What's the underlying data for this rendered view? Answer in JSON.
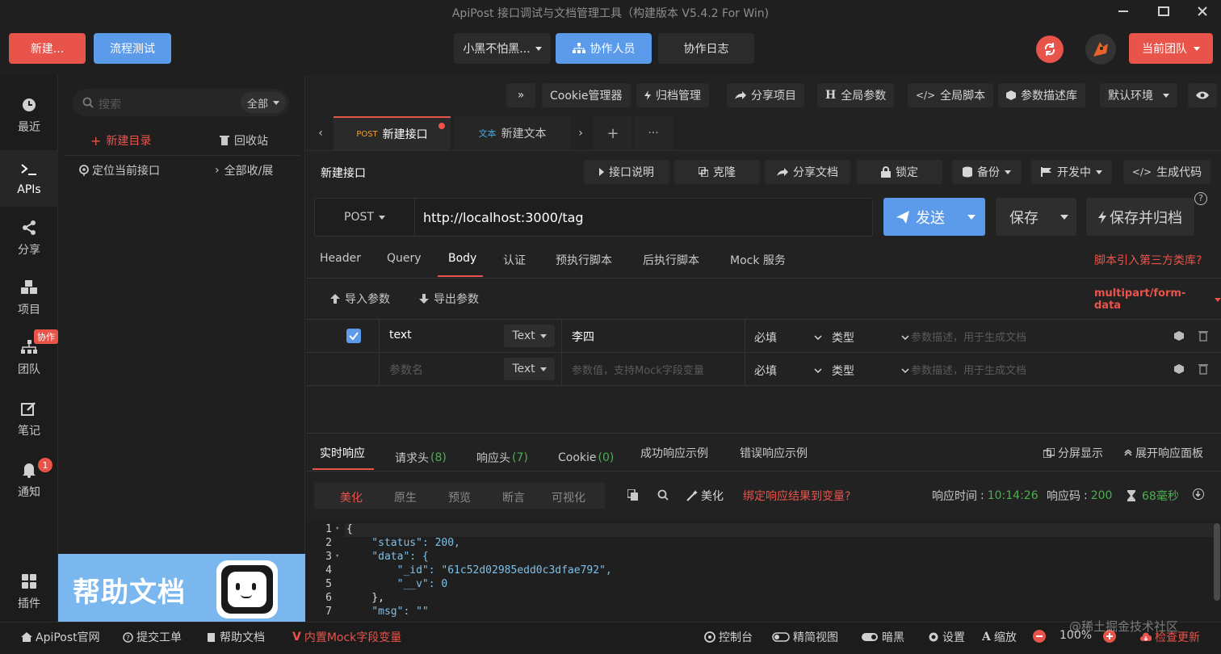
{
  "window": {
    "title": "ApiPost 接口调试与文档管理工具（构建版本 V5.4.2 For Win)"
  },
  "header": {
    "new_label": "新建...",
    "flow_test_label": "流程测试",
    "project_select": "小黑不怕黑...",
    "collaborators_label": "协作人员",
    "collab_log_label": "协作日志",
    "team_label": "当前团队"
  },
  "leftnav": {
    "items": [
      {
        "label": "最近",
        "icon": "clock-icon"
      },
      {
        "label": "APIs",
        "icon": "terminal-icon"
      },
      {
        "label": "分享",
        "icon": "share-icon"
      },
      {
        "label": "项目",
        "icon": "cubes-icon"
      },
      {
        "label": "团队",
        "icon": "sitemap-icon",
        "badge": "协作"
      },
      {
        "label": "笔记",
        "icon": "edit-icon"
      },
      {
        "label": "通知",
        "icon": "bell-icon",
        "badge": "1"
      },
      {
        "label": "插件",
        "icon": "grid-icon"
      }
    ]
  },
  "tree": {
    "search_placeholder": "搜索",
    "scope": "全部",
    "new_dir": "新建目录",
    "recycle": "回收站",
    "locate": "定位当前接口",
    "collapse_all": "全部收/展",
    "help_banner": "帮助文档"
  },
  "toolbar": {
    "expand": "»",
    "cookie": "Cookie管理器",
    "archive": "归档管理",
    "share_project": "分享项目",
    "global_params": "全局参数",
    "global_script": "全局脚本",
    "param_lib": "参数描述库",
    "env": "默认环境"
  },
  "tabs": [
    {
      "method": "POST",
      "name": "新建接口",
      "active": true,
      "dot": true
    },
    {
      "method": "文本",
      "name": "新建文本",
      "active": false
    }
  ],
  "tab_controls": {
    "add": "+",
    "more": "···"
  },
  "api": {
    "name": "新建接口",
    "doc_btn": "接口说明",
    "clone_btn": "克隆",
    "share_doc_btn": "分享文档",
    "lock_btn": "锁定",
    "backup_btn": "备份",
    "status_btn": "开发中",
    "gen_code_btn": "生成代码",
    "method": "POST",
    "url": "http://localhost:3000/tag",
    "send": "发送",
    "save": "保存",
    "save_archive": "保存并归档"
  },
  "request_tabs": [
    "Header",
    "Query",
    "Body",
    "认证",
    "预执行脚本",
    "后执行脚本",
    "Mock 服务"
  ],
  "request_tab_active": "Body",
  "third_party_lib": "脚本引入第三方类库?",
  "body": {
    "import": "导入参数",
    "export": "导出参数",
    "content_type": "multipart/form-data",
    "rows": [
      {
        "checked": true,
        "key": "text",
        "type": "Text",
        "value": "李四",
        "required": "必填",
        "kind": "类型",
        "desc_placeholder": "参数描述，用于生成文档"
      },
      {
        "checked": false,
        "key_placeholder": "参数名",
        "type": "Text",
        "value_placeholder": "参数值，支持Mock字段变量",
        "required": "必填",
        "kind": "类型",
        "desc_placeholder": "参数描述，用于生成文档"
      }
    ]
  },
  "response": {
    "tabs": [
      {
        "label": "实时响应",
        "count": ""
      },
      {
        "label": "请求头",
        "count": "(8)"
      },
      {
        "label": "响应头",
        "count": "(7)"
      },
      {
        "label": "Cookie",
        "count": "(0)"
      },
      {
        "label": "成功响应示例",
        "count": ""
      },
      {
        "label": "错误响应示例",
        "count": ""
      }
    ],
    "split": "分屏显示",
    "expand_panel": "展开响应面板",
    "formats": [
      "美化",
      "原生",
      "预览",
      "断言",
      "可视化"
    ],
    "beautify": "美化",
    "bind_var": "绑定响应结果到变量?",
    "time_label": "响应时间",
    "time_value": "10:14:26",
    "code_label": "响应码",
    "code_value": "200",
    "duration": "68毫秒",
    "code_lines": [
      {
        "n": "1",
        "text": "{"
      },
      {
        "n": "2",
        "text": "    \"status\": 200,"
      },
      {
        "n": "3",
        "text": "    \"data\": {"
      },
      {
        "n": "4",
        "text": "        \"_id\": \"61c52d02985edd0c3dfae792\","
      },
      {
        "n": "5",
        "text": "        \"__v\": 0"
      },
      {
        "n": "6",
        "text": "    },"
      },
      {
        "n": "7",
        "text": "    \"msg\": \"\""
      }
    ]
  },
  "footer": {
    "site": "ApiPost官网",
    "ticket": "提交工单",
    "help": "帮助文档",
    "mock": "内置Mock字段变量",
    "console": "控制台",
    "simple": "精简视图",
    "dark": "暗黑",
    "settings": "设置",
    "zoom_label": "缩放",
    "zoom": "100%",
    "update": "检查更新",
    "watermark": "@稀土掘金技术社区"
  },
  "colors": {
    "accent_red": "#e74c3c",
    "accent_blue": "#5b9bea",
    "green": "#4caf50",
    "string": "#7ec0e6",
    "number": "#f0c040"
  }
}
